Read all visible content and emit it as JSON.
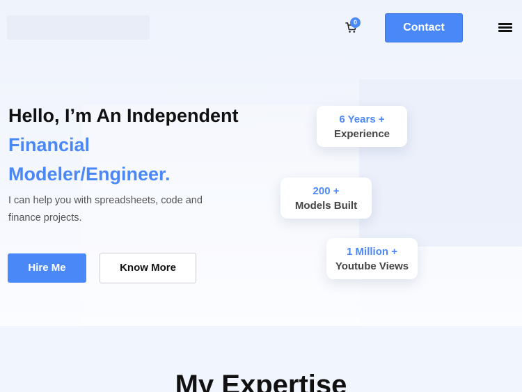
{
  "header": {
    "cart_count": "0",
    "cart_icon": "cart-icon",
    "contact_label": "Contact",
    "menu_icon": "hamburger-menu-icon"
  },
  "hero": {
    "headline_line1": "Hello, I’m An Independent",
    "headline_line2": "Financial",
    "headline_line3": "Modeler/Engineer.",
    "subtext": "I can help you with spreadsheets, code and finance projects.",
    "hire_label": "Hire Me",
    "know_more_label": "Know More"
  },
  "stats": [
    {
      "value": "6 Years +",
      "label": "Experience"
    },
    {
      "value": "200 +",
      "label": "Models Built"
    },
    {
      "value": "1 Million +",
      "label": "Youtube Views"
    }
  ],
  "section": {
    "expertise_title": "My Expertise"
  },
  "colors": {
    "accent": "#4b88f7",
    "background": "#f1f5fd",
    "text_dark": "#111111"
  }
}
